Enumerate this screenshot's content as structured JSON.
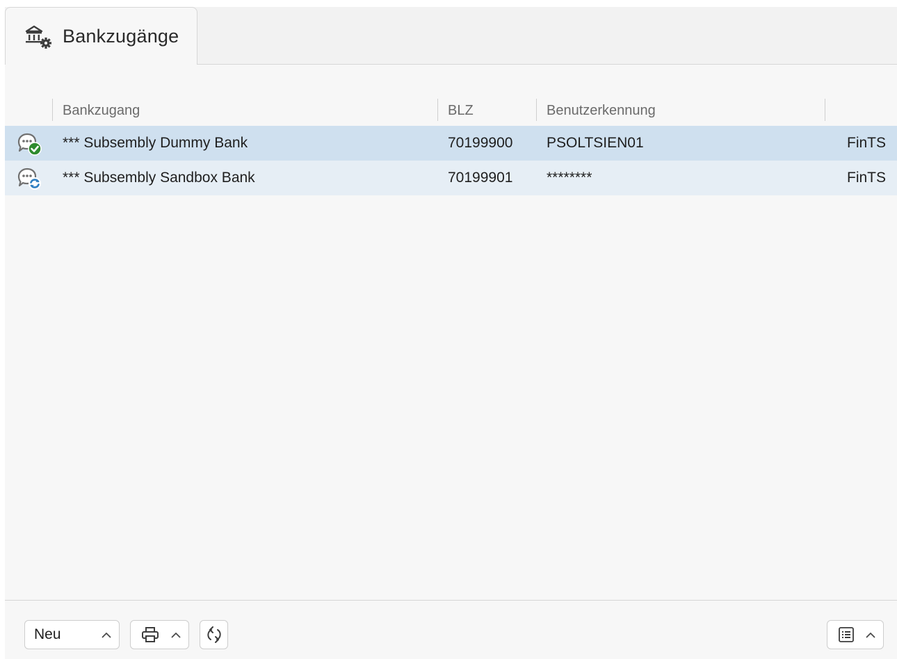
{
  "tab": {
    "title": "Bankzugänge",
    "icon": "bank-settings-icon"
  },
  "table": {
    "columns": [
      "Bankzugang",
      "BLZ",
      "Benutzerkennung",
      ""
    ],
    "rows": [
      {
        "status_icon": "chat-check-icon",
        "name": "*** Subsembly Dummy Bank",
        "blz": "70199900",
        "user": "PSOLTSIEN01",
        "type": "FinTS"
      },
      {
        "status_icon": "chat-sync-icon",
        "name": "*** Subsembly Sandbox Bank",
        "blz": "70199901",
        "user": "********",
        "type": "FinTS"
      }
    ]
  },
  "footer": {
    "new_label": "Neu",
    "print_icon": "printer-icon",
    "refresh_icon": "refresh-icon",
    "view_icon": "list-view-icon"
  },
  "colors": {
    "selected_row": "#cfe0ef",
    "second_row": "#e6eef5",
    "check_green": "#2e8b2e",
    "sync_blue": "#2f7fc1"
  }
}
